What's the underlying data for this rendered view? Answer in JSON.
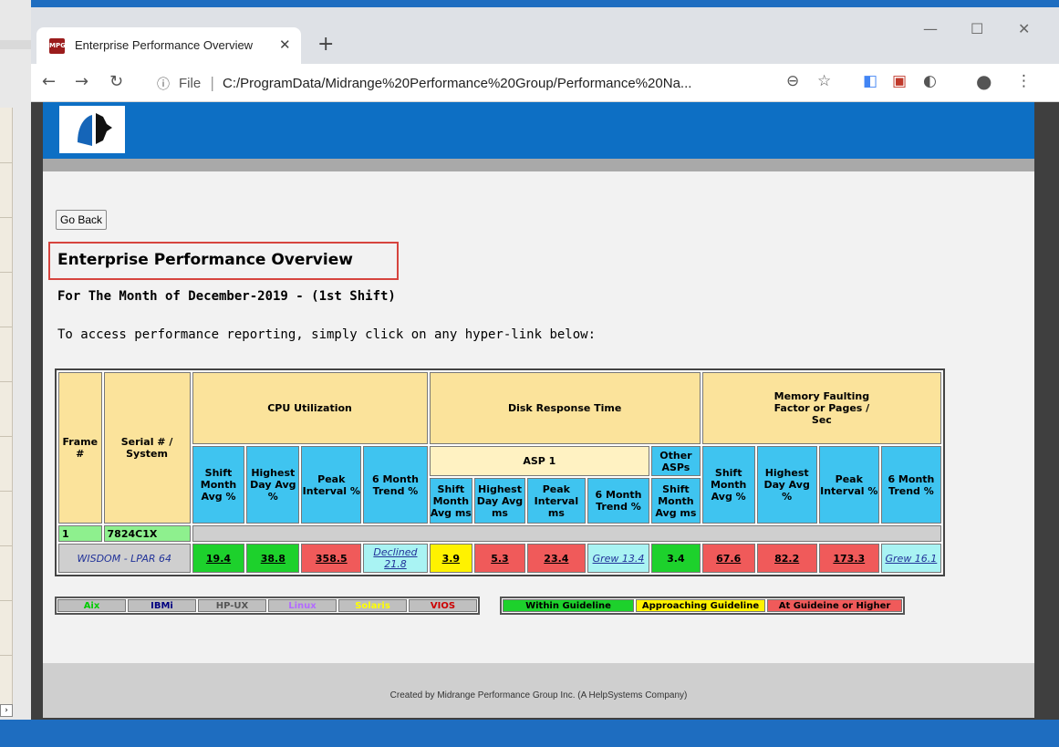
{
  "browser": {
    "tab_title": "Enterprise Performance Overview",
    "favicon_text": "MPG",
    "url_scheme": "File",
    "url": "C:/ProgramData/Midrange%20Performance%20Group/Performance%20Na..."
  },
  "page": {
    "go_back_label": "Go Back",
    "title": "Enterprise Performance Overview",
    "subtitle": "For The Month of December-2019 - (1st Shift)",
    "instructions": "To access performance reporting, simply click on any hyper-link below:"
  },
  "table": {
    "frame_header": "Frame #",
    "serial_header": "Serial # / System",
    "cpu_header": "CPU Utilization",
    "disk_header": "Disk Response Time",
    "memory_header": "Memory Faulting Factor or Pages / Sec",
    "asp1_header": "ASP 1",
    "other_asps_header": "Other ASPs",
    "cpu_cols": [
      "Shift Month Avg %",
      "Highest Day Avg %",
      "Peak Interval %",
      "6 Month Trend %"
    ],
    "asp1_cols": [
      "Shift Month Avg ms",
      "Highest Day Avg ms",
      "Peak Interval ms",
      "6 Month Trend %"
    ],
    "other_asps_col": "Shift Month Avg ms",
    "mem_cols": [
      "Shift Month Avg %",
      "Highest Day Avg %",
      "Peak Interval %",
      "6 Month Trend %"
    ],
    "frame": {
      "number": "1",
      "serial": "7824C1X"
    },
    "system_row": {
      "name": "WISDOM - LPAR 64",
      "cpu": [
        "19.4",
        "38.8",
        "358.5",
        "Declined 21.8"
      ],
      "asp1": [
        "3.9",
        "5.3",
        "23.4",
        "Grew 13.4"
      ],
      "other_asps": "3.4",
      "mem": [
        "67.6",
        "82.2",
        "173.3",
        "Grew 16.1"
      ]
    }
  },
  "legend": {
    "os": [
      "Aix",
      "IBMi",
      "HP-UX",
      "Linux",
      "Solaris",
      "VIOS"
    ],
    "os_colors": [
      "#00cc00",
      "#000080",
      "#555555",
      "#b36bff",
      "#ffff00",
      "#cc0000"
    ],
    "guidelines": [
      "Within Guideline",
      "Approaching Guideline",
      "At Guideine or Higher"
    ],
    "guideline_colors": [
      "#1dd12c",
      "#fff200",
      "#f05a5a"
    ]
  },
  "footer": "Created by Midrange Performance Group Inc. (A HelpSystems Company)"
}
